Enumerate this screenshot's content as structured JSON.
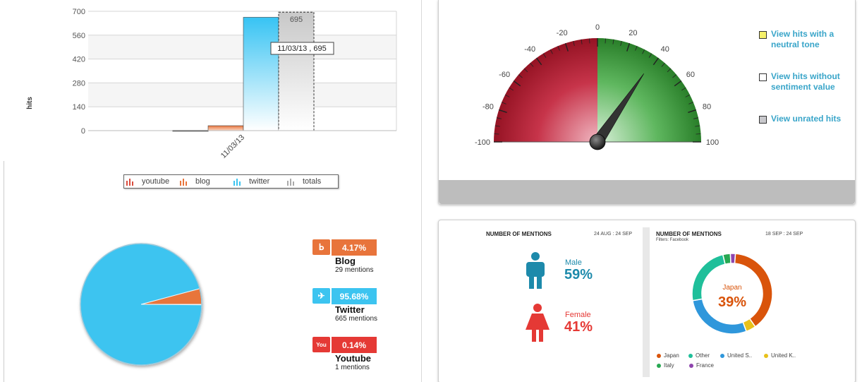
{
  "bar_chart": {
    "type": "bar",
    "categories": [
      "11/03/13"
    ],
    "series": [
      {
        "name": "youtube",
        "values": [
          1
        ],
        "color": "#d94c3d"
      },
      {
        "name": "blog",
        "values": [
          29
        ],
        "color": "#e8743b"
      },
      {
        "name": "twitter",
        "values": [
          665
        ],
        "color": "#3cc4f0"
      },
      {
        "name": "totals",
        "values": [
          695
        ],
        "color": "#cfcfcf"
      }
    ],
    "ylabel": "hits",
    "ylim": [
      0,
      700
    ],
    "yticks": [
      "700",
      "560",
      "420",
      "280",
      "140",
      "0"
    ],
    "tooltip": "11/03/13 , 695",
    "total_label": "695",
    "grid": true,
    "legend_position": "bottom"
  },
  "pie_chart": {
    "type": "pie",
    "slices": [
      {
        "name": "Twitter",
        "value": 95.68,
        "color": "#3cc4f0"
      },
      {
        "name": "Blog",
        "value": 4.17,
        "color": "#e8743b"
      },
      {
        "name": "Youtube",
        "value": 0.14,
        "color": "#e53935"
      }
    ]
  },
  "sources": [
    {
      "name": "Blog",
      "percent": "4.17%",
      "mentions": "29 mentions",
      "icon": "rss-icon",
      "icon_glyph": "ᖯ",
      "color": "#e8743b"
    },
    {
      "name": "Twitter",
      "percent": "95.68%",
      "mentions": "665 mentions",
      "icon": "twitter-bird-icon",
      "icon_glyph": "✈",
      "color": "#3cc4f0"
    },
    {
      "name": "Youtube",
      "percent": "0.14%",
      "mentions": "1 mentions",
      "icon": "youtube-icon",
      "icon_glyph": "You",
      "color": "#e53935"
    }
  ],
  "gauge": {
    "type": "gauge",
    "min": -100,
    "max": 100,
    "value": 38,
    "tick_labels": [
      "-100",
      "-80",
      "-60",
      "-40",
      "-20",
      "0",
      "20",
      "40",
      "60",
      "80",
      "100"
    ],
    "negative_color": "#a8162a",
    "positive_color": "#2e8b2e"
  },
  "gauge_toggles": [
    {
      "label": "View hits with a neutral tone",
      "color": "#f5f06a"
    },
    {
      "label": "View hits without sentiment value",
      "color": "#ffffff"
    },
    {
      "label": "View unrated hits",
      "color": "#c8c8cc"
    }
  ],
  "gender": {
    "heading": "NUMBER OF MENTIONS",
    "range": "24 AUG : 24 SEP",
    "male_label": "Male",
    "male_pct": "59%",
    "female_label": "Female",
    "female_pct": "41%",
    "male_color": "#1d8aab",
    "female_color": "#e53935"
  },
  "country": {
    "heading": "NUMBER OF MENTIONS",
    "range": "18 SEP : 24 SEP",
    "filters": "Filters: Facebook",
    "center_label": "Japan",
    "center_pct": "39%",
    "chart_data": {
      "type": "pie",
      "slices": [
        {
          "name": "Japan",
          "value": 39,
          "color": "#d9540b"
        },
        {
          "name": "United K..",
          "value": 4,
          "color": "#e8c11a"
        },
        {
          "name": "United S..",
          "value": 28,
          "color": "#2f97db"
        },
        {
          "name": "Other",
          "value": 24,
          "color": "#1fbf9a"
        },
        {
          "name": "Italy",
          "value": 3,
          "color": "#27a852"
        },
        {
          "name": "France",
          "value": 2,
          "color": "#8e44ad"
        }
      ]
    },
    "legend": [
      "Japan",
      "Other",
      "United S..",
      "United K..",
      "Italy",
      "France"
    ]
  }
}
